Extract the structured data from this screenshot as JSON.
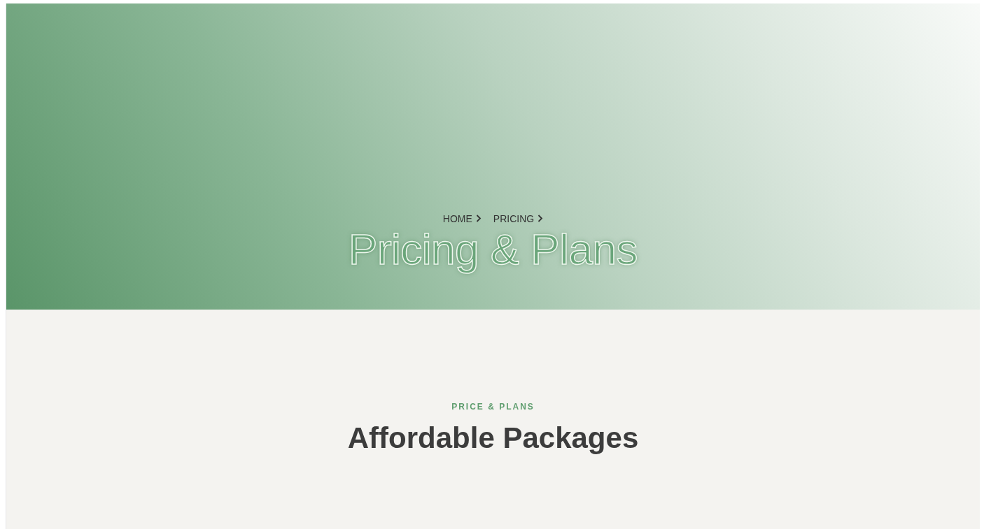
{
  "breadcrumb": [
    {
      "label": "HOME"
    },
    {
      "label": "PRICING"
    }
  ],
  "hero": {
    "title": "Pricing & Plans"
  },
  "section": {
    "eyebrow": "PRICE & PLANS",
    "heading": "Affordable Packages"
  }
}
